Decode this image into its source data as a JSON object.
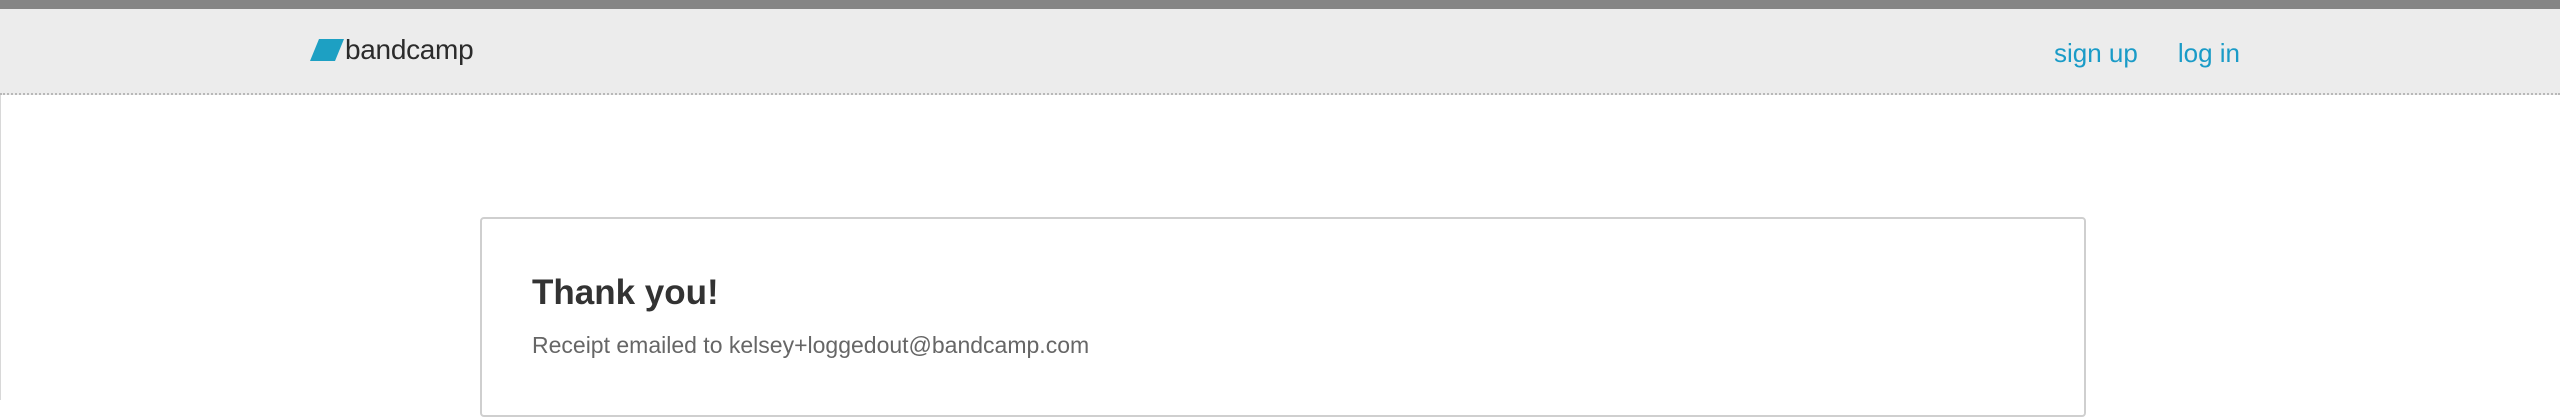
{
  "header": {
    "logo_text": "bandcamp",
    "logo_color": "#1da0c3",
    "nav": {
      "sign_up": "sign up",
      "log_in": "log in"
    },
    "link_color": "#1a9bc7"
  },
  "main": {
    "title": "Thank you!",
    "receipt_message": "Receipt emailed to kelsey+loggedout@bandcamp.com"
  }
}
